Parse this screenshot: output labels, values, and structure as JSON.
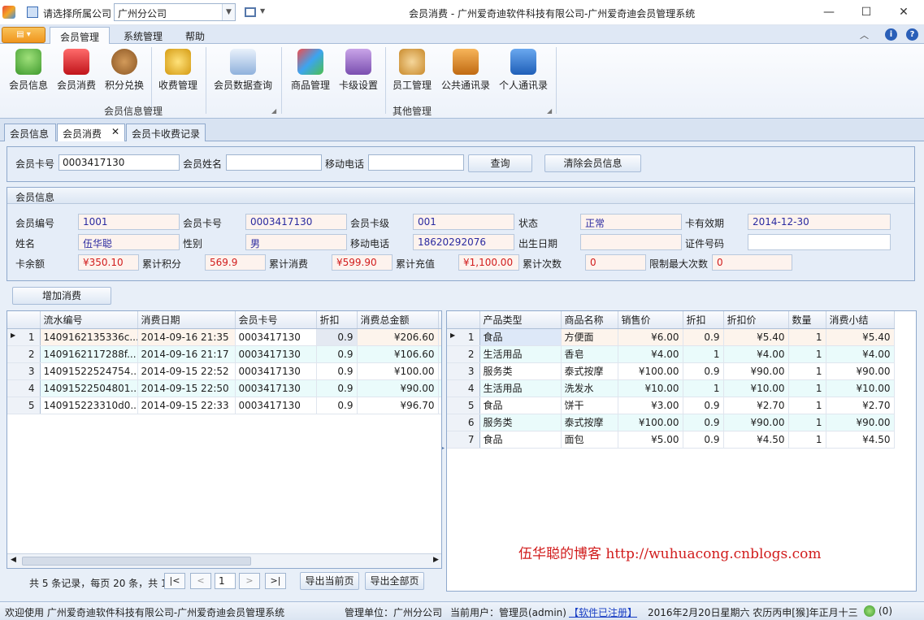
{
  "titlebar": {
    "company_prompt": "请选择所属公司",
    "company_value": "广州分公司",
    "window_title": "会员消费 - 广州爱奇迪软件科技有限公司-广州爱奇迪会员管理系统"
  },
  "menu": {
    "tabs": [
      "会员管理",
      "系统管理",
      "帮助"
    ]
  },
  "ribbon": {
    "buttons": [
      "会员信息",
      "会员消费",
      "积分兑换",
      "收费管理",
      "会员数据查询",
      "商品管理",
      "卡级设置",
      "员工管理",
      "公共通讯录",
      "个人通讯录"
    ],
    "groups": [
      "会员信息管理",
      "其他管理"
    ]
  },
  "doc_tabs": [
    "会员信息",
    "会员消费",
    "会员卡收费记录"
  ],
  "search": {
    "card_label": "会员卡号",
    "card_value": "0003417130",
    "name_label": "会员姓名",
    "name_value": "",
    "phone_label": "移动电话",
    "phone_value": "",
    "query_btn": "查询",
    "clear_btn": "清除会员信息"
  },
  "info": {
    "title": "会员信息",
    "labels": {
      "member_no": "会员编号",
      "card_no": "会员卡号",
      "card_level": "会员卡级",
      "status": "状态",
      "valid": "卡有效期",
      "name": "姓名",
      "gender": "性别",
      "phone": "移动电话",
      "birth": "出生日期",
      "id_no": "证件号码",
      "balance": "卡余额",
      "points": "累计积分",
      "consume": "累计消费",
      "recharge": "累计充值",
      "times": "累计次数",
      "max_times": "限制最大次数"
    },
    "values": {
      "member_no": "1001",
      "card_no": "0003417130",
      "card_level": "001",
      "status": "正常",
      "valid": "2014-12-30",
      "name": "伍华聪",
      "gender": "男",
      "phone": "18620292076",
      "birth": "",
      "id_no": "",
      "balance": "¥350.10",
      "points": "569.9",
      "consume": "¥599.90",
      "recharge": "¥1,100.00",
      "times": "0",
      "max_times": "0"
    }
  },
  "add_btn": "增加消费",
  "left_grid": {
    "headers": [
      "流水编号",
      "消费日期",
      "会员卡号",
      "折扣",
      "消费总金额"
    ],
    "rows": [
      [
        "1409162135336c...",
        "2014-09-16 21:35",
        "0003417130",
        "0.9",
        "¥206.60"
      ],
      [
        "1409162117288f...",
        "2014-09-16 21:17",
        "0003417130",
        "0.9",
        "¥106.60"
      ],
      [
        "14091522524754...",
        "2014-09-15 22:52",
        "0003417130",
        "0.9",
        "¥100.00"
      ],
      [
        "14091522504801...",
        "2014-09-15 22:50",
        "0003417130",
        "0.9",
        "¥90.00"
      ],
      [
        "140915223310d0...",
        "2014-09-15 22:33",
        "0003417130",
        "0.9",
        "¥96.70"
      ]
    ]
  },
  "right_grid": {
    "headers": [
      "产品类型",
      "商品名称",
      "销售价",
      "折扣",
      "折扣价",
      "数量",
      "消费小结"
    ],
    "rows": [
      [
        "食品",
        "方便面",
        "¥6.00",
        "0.9",
        "¥5.40",
        "1",
        "¥5.40"
      ],
      [
        "生活用品",
        "香皂",
        "¥4.00",
        "1",
        "¥4.00",
        "1",
        "¥4.00"
      ],
      [
        "服务类",
        "泰式按摩",
        "¥100.00",
        "0.9",
        "¥90.00",
        "1",
        "¥90.00"
      ],
      [
        "生活用品",
        "洗发水",
        "¥10.00",
        "1",
        "¥10.00",
        "1",
        "¥10.00"
      ],
      [
        "食品",
        "饼干",
        "¥3.00",
        "0.9",
        "¥2.70",
        "1",
        "¥2.70"
      ],
      [
        "服务类",
        "泰式按摩",
        "¥100.00",
        "0.9",
        "¥90.00",
        "1",
        "¥90.00"
      ],
      [
        "食品",
        "面包",
        "¥5.00",
        "0.9",
        "¥4.50",
        "1",
        "¥4.50"
      ]
    ]
  },
  "pager": {
    "summary": "共 5 条记录，每页 20 条，共 1",
    "first": "|<",
    "prev": "<",
    "page": "1",
    "next": ">",
    "last": ">|",
    "export_current": "导出当前页",
    "export_all": "导出全部页"
  },
  "watermark": "伍华聪的博客 http://wuhuacong.cnblogs.com",
  "status": {
    "welcome": "欢迎使用 广州爱奇迪软件科技有限公司-广州爱奇迪会员管理系统",
    "unit": "管理单位：广州分公司",
    "user": "当前用户：管理员(admin)",
    "registered": "【软件已注册】",
    "date": "2016年2月20日星期六 农历丙申[猴]年正月十三",
    "count": "(0)"
  },
  "colors": {
    "accent": "#f5a623",
    "link": "#1a3fc4",
    "value_text": "#2a2aa0",
    "money": "#d11c1c"
  }
}
